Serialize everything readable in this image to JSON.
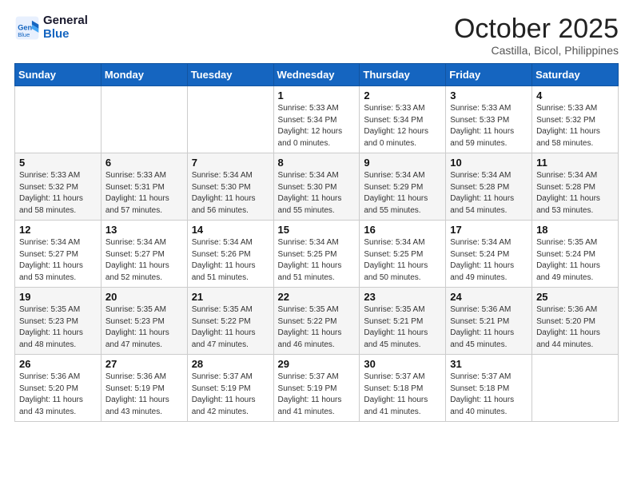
{
  "header": {
    "logo_line1": "General",
    "logo_line2": "Blue",
    "month": "October 2025",
    "location": "Castilla, Bicol, Philippines"
  },
  "weekdays": [
    "Sunday",
    "Monday",
    "Tuesday",
    "Wednesday",
    "Thursday",
    "Friday",
    "Saturday"
  ],
  "weeks": [
    [
      {
        "day": "",
        "sunrise": "",
        "sunset": "",
        "daylight": ""
      },
      {
        "day": "",
        "sunrise": "",
        "sunset": "",
        "daylight": ""
      },
      {
        "day": "",
        "sunrise": "",
        "sunset": "",
        "daylight": ""
      },
      {
        "day": "1",
        "sunrise": "Sunrise: 5:33 AM",
        "sunset": "Sunset: 5:34 PM",
        "daylight": "Daylight: 12 hours and 0 minutes."
      },
      {
        "day": "2",
        "sunrise": "Sunrise: 5:33 AM",
        "sunset": "Sunset: 5:34 PM",
        "daylight": "Daylight: 12 hours and 0 minutes."
      },
      {
        "day": "3",
        "sunrise": "Sunrise: 5:33 AM",
        "sunset": "Sunset: 5:33 PM",
        "daylight": "Daylight: 11 hours and 59 minutes."
      },
      {
        "day": "4",
        "sunrise": "Sunrise: 5:33 AM",
        "sunset": "Sunset: 5:32 PM",
        "daylight": "Daylight: 11 hours and 58 minutes."
      }
    ],
    [
      {
        "day": "5",
        "sunrise": "Sunrise: 5:33 AM",
        "sunset": "Sunset: 5:32 PM",
        "daylight": "Daylight: 11 hours and 58 minutes."
      },
      {
        "day": "6",
        "sunrise": "Sunrise: 5:33 AM",
        "sunset": "Sunset: 5:31 PM",
        "daylight": "Daylight: 11 hours and 57 minutes."
      },
      {
        "day": "7",
        "sunrise": "Sunrise: 5:34 AM",
        "sunset": "Sunset: 5:30 PM",
        "daylight": "Daylight: 11 hours and 56 minutes."
      },
      {
        "day": "8",
        "sunrise": "Sunrise: 5:34 AM",
        "sunset": "Sunset: 5:30 PM",
        "daylight": "Daylight: 11 hours and 55 minutes."
      },
      {
        "day": "9",
        "sunrise": "Sunrise: 5:34 AM",
        "sunset": "Sunset: 5:29 PM",
        "daylight": "Daylight: 11 hours and 55 minutes."
      },
      {
        "day": "10",
        "sunrise": "Sunrise: 5:34 AM",
        "sunset": "Sunset: 5:28 PM",
        "daylight": "Daylight: 11 hours and 54 minutes."
      },
      {
        "day": "11",
        "sunrise": "Sunrise: 5:34 AM",
        "sunset": "Sunset: 5:28 PM",
        "daylight": "Daylight: 11 hours and 53 minutes."
      }
    ],
    [
      {
        "day": "12",
        "sunrise": "Sunrise: 5:34 AM",
        "sunset": "Sunset: 5:27 PM",
        "daylight": "Daylight: 11 hours and 53 minutes."
      },
      {
        "day": "13",
        "sunrise": "Sunrise: 5:34 AM",
        "sunset": "Sunset: 5:27 PM",
        "daylight": "Daylight: 11 hours and 52 minutes."
      },
      {
        "day": "14",
        "sunrise": "Sunrise: 5:34 AM",
        "sunset": "Sunset: 5:26 PM",
        "daylight": "Daylight: 11 hours and 51 minutes."
      },
      {
        "day": "15",
        "sunrise": "Sunrise: 5:34 AM",
        "sunset": "Sunset: 5:25 PM",
        "daylight": "Daylight: 11 hours and 51 minutes."
      },
      {
        "day": "16",
        "sunrise": "Sunrise: 5:34 AM",
        "sunset": "Sunset: 5:25 PM",
        "daylight": "Daylight: 11 hours and 50 minutes."
      },
      {
        "day": "17",
        "sunrise": "Sunrise: 5:34 AM",
        "sunset": "Sunset: 5:24 PM",
        "daylight": "Daylight: 11 hours and 49 minutes."
      },
      {
        "day": "18",
        "sunrise": "Sunrise: 5:35 AM",
        "sunset": "Sunset: 5:24 PM",
        "daylight": "Daylight: 11 hours and 49 minutes."
      }
    ],
    [
      {
        "day": "19",
        "sunrise": "Sunrise: 5:35 AM",
        "sunset": "Sunset: 5:23 PM",
        "daylight": "Daylight: 11 hours and 48 minutes."
      },
      {
        "day": "20",
        "sunrise": "Sunrise: 5:35 AM",
        "sunset": "Sunset: 5:23 PM",
        "daylight": "Daylight: 11 hours and 47 minutes."
      },
      {
        "day": "21",
        "sunrise": "Sunrise: 5:35 AM",
        "sunset": "Sunset: 5:22 PM",
        "daylight": "Daylight: 11 hours and 47 minutes."
      },
      {
        "day": "22",
        "sunrise": "Sunrise: 5:35 AM",
        "sunset": "Sunset: 5:22 PM",
        "daylight": "Daylight: 11 hours and 46 minutes."
      },
      {
        "day": "23",
        "sunrise": "Sunrise: 5:35 AM",
        "sunset": "Sunset: 5:21 PM",
        "daylight": "Daylight: 11 hours and 45 minutes."
      },
      {
        "day": "24",
        "sunrise": "Sunrise: 5:36 AM",
        "sunset": "Sunset: 5:21 PM",
        "daylight": "Daylight: 11 hours and 45 minutes."
      },
      {
        "day": "25",
        "sunrise": "Sunrise: 5:36 AM",
        "sunset": "Sunset: 5:20 PM",
        "daylight": "Daylight: 11 hours and 44 minutes."
      }
    ],
    [
      {
        "day": "26",
        "sunrise": "Sunrise: 5:36 AM",
        "sunset": "Sunset: 5:20 PM",
        "daylight": "Daylight: 11 hours and 43 minutes."
      },
      {
        "day": "27",
        "sunrise": "Sunrise: 5:36 AM",
        "sunset": "Sunset: 5:19 PM",
        "daylight": "Daylight: 11 hours and 43 minutes."
      },
      {
        "day": "28",
        "sunrise": "Sunrise: 5:37 AM",
        "sunset": "Sunset: 5:19 PM",
        "daylight": "Daylight: 11 hours and 42 minutes."
      },
      {
        "day": "29",
        "sunrise": "Sunrise: 5:37 AM",
        "sunset": "Sunset: 5:19 PM",
        "daylight": "Daylight: 11 hours and 41 minutes."
      },
      {
        "day": "30",
        "sunrise": "Sunrise: 5:37 AM",
        "sunset": "Sunset: 5:18 PM",
        "daylight": "Daylight: 11 hours and 41 minutes."
      },
      {
        "day": "31",
        "sunrise": "Sunrise: 5:37 AM",
        "sunset": "Sunset: 5:18 PM",
        "daylight": "Daylight: 11 hours and 40 minutes."
      },
      {
        "day": "",
        "sunrise": "",
        "sunset": "",
        "daylight": ""
      }
    ]
  ]
}
